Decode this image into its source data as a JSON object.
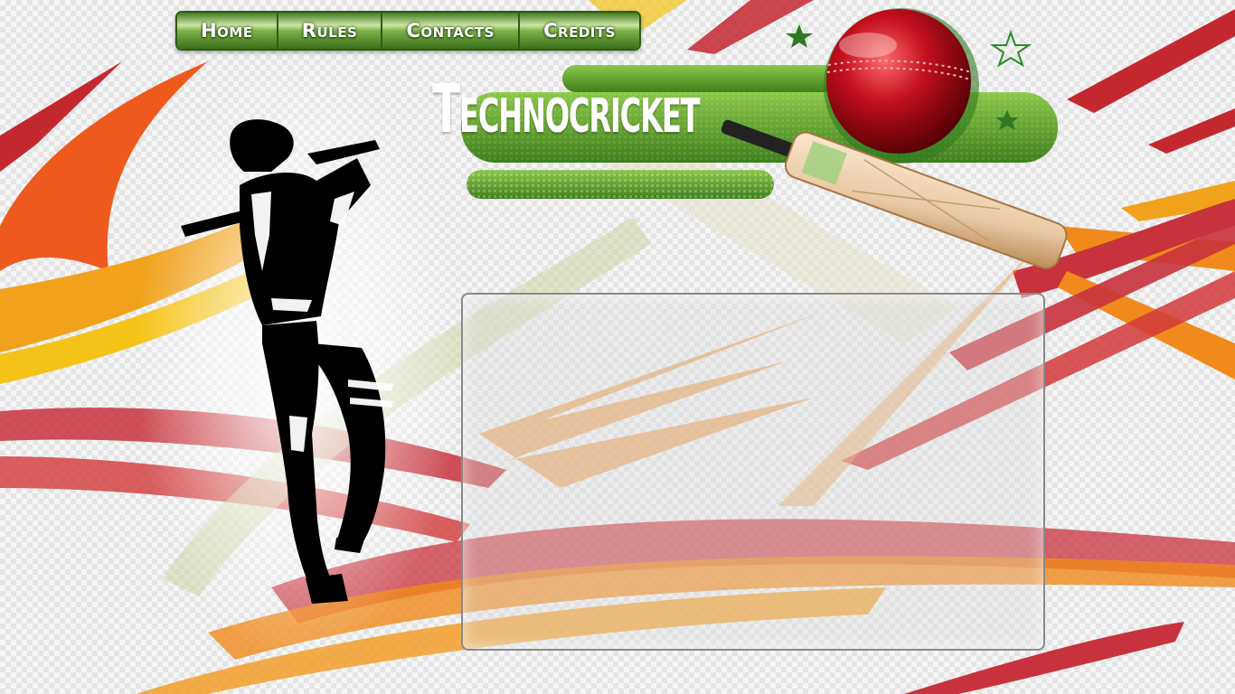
{
  "nav": {
    "items": [
      {
        "label": "Home"
      },
      {
        "label": "Rules"
      },
      {
        "label": "Contacts"
      },
      {
        "label": "Credits"
      }
    ]
  },
  "header": {
    "title": "Technocricket"
  },
  "colors": {
    "nav_green": "#4a8a24",
    "brand_green": "#6aa83a",
    "ball_red": "#b3000f",
    "stripe_red": "#c8323c",
    "stripe_orange": "#ee8a1c",
    "stripe_yellow": "#f2c21a",
    "silhouette": "#000000"
  },
  "icons": {
    "batsman": "cricket-batsman-silhouette",
    "ball": "cricket-ball",
    "bat": "cricket-bat",
    "stars": "star-decoration"
  }
}
